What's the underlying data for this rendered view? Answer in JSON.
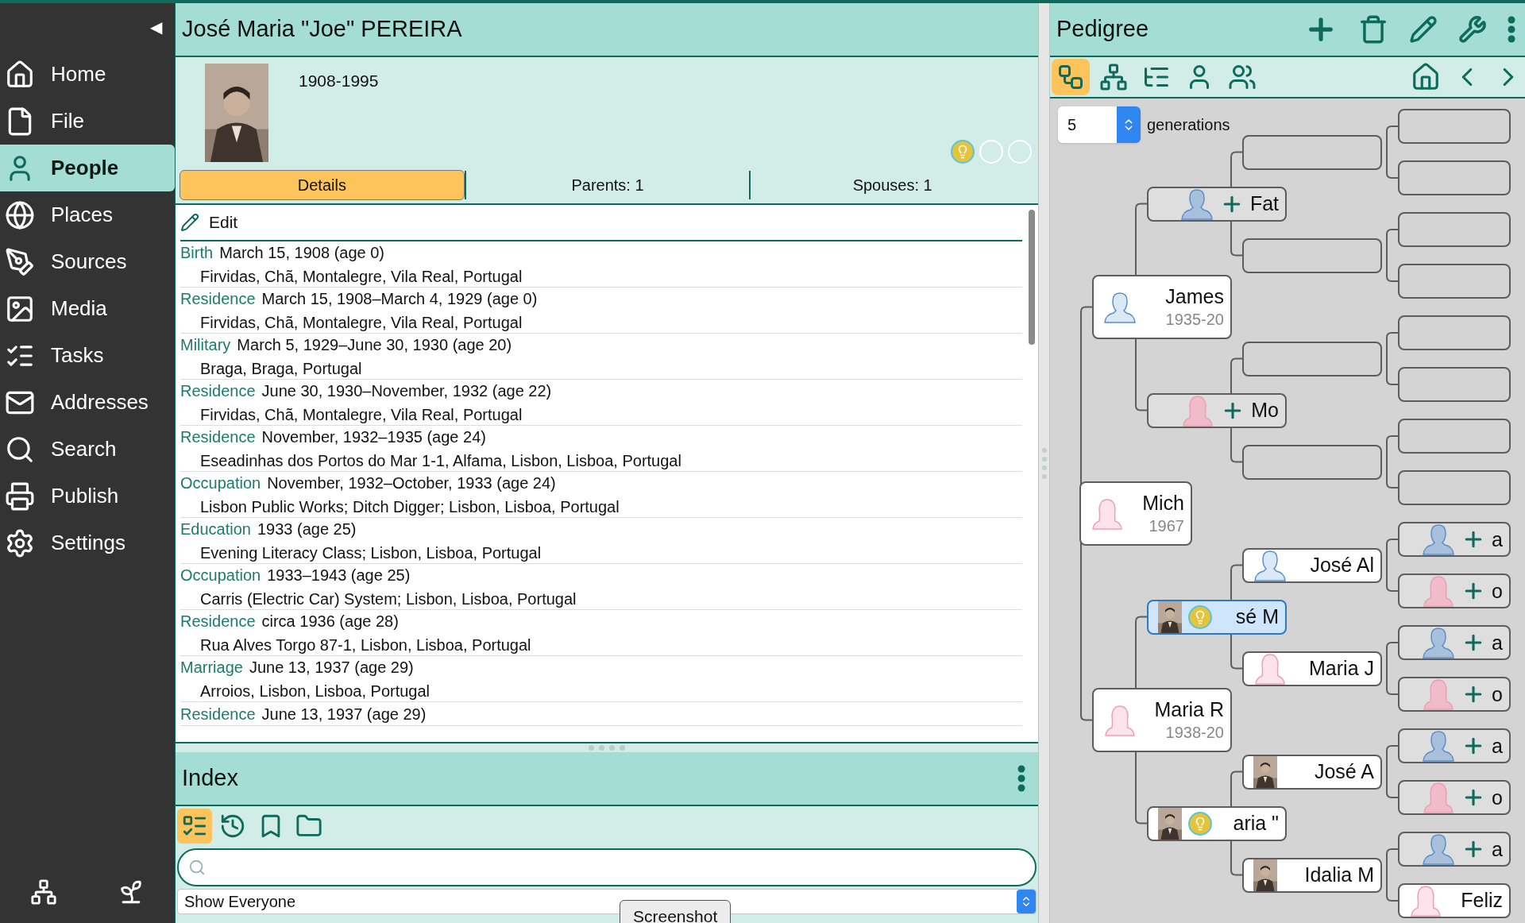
{
  "sidebar": {
    "collapse": "◀",
    "items": [
      {
        "label": "Home",
        "selected": false
      },
      {
        "label": "File",
        "selected": false
      },
      {
        "label": "People",
        "selected": true
      },
      {
        "label": "Places",
        "selected": false
      },
      {
        "label": "Sources",
        "selected": false
      },
      {
        "label": "Media",
        "selected": false
      },
      {
        "label": "Tasks",
        "selected": false
      },
      {
        "label": "Addresses",
        "selected": false
      },
      {
        "label": "Search",
        "selected": false
      },
      {
        "label": "Publish",
        "selected": false
      },
      {
        "label": "Settings",
        "selected": false
      }
    ]
  },
  "person": {
    "name": "José Maria \"Joe\" PEREIRA",
    "dates": "1908-1995",
    "hints": [
      {
        "filled": true
      },
      {
        "filled": false
      },
      {
        "filled": false
      }
    ]
  },
  "tabs": [
    {
      "label": "Details",
      "selected": true
    },
    {
      "label": "Parents: 1",
      "selected": false
    },
    {
      "label": "Spouses: 1",
      "selected": false
    }
  ],
  "edit_label": "Edit",
  "events": [
    {
      "type": "Birth",
      "date": "March 15, 1908 (age 0)",
      "place": "Firvidas, Chã, Montalegre, Vila Real, Portugal"
    },
    {
      "type": "Residence",
      "date": "March 15, 1908–March 4, 1929 (age 0)",
      "place": "Firvidas, Chã, Montalegre, Vila Real, Portugal"
    },
    {
      "type": "Military",
      "date": "March 5, 1929–June 30, 1930 (age 20)",
      "place": "Braga, Braga, Portugal"
    },
    {
      "type": "Residence",
      "date": "June 30, 1930–November, 1932 (age 22)",
      "place": "Firvidas, Chã, Montalegre, Vila Real, Portugal"
    },
    {
      "type": "Residence",
      "date": "November, 1932–1935 (age 24)",
      "place": "Eseadinhas dos Portos do Mar 1-1, Alfama, Lisbon, Lisboa, Portugal"
    },
    {
      "type": "Occupation",
      "date": "November, 1932–October, 1933 (age 24)",
      "place": "Lisbon Public Works; Ditch Digger; Lisbon, Lisboa, Portugal"
    },
    {
      "type": "Education",
      "date": "1933 (age 25)",
      "place": "Evening Literacy Class; Lisbon, Lisboa, Portugal"
    },
    {
      "type": "Occupation",
      "date": "1933–1943 (age 25)",
      "place": "Carris (Electric Car) System; Lisbon, Lisboa, Portugal"
    },
    {
      "type": "Residence",
      "date": "circa 1936 (age 28)",
      "place": "Rua Alves Torgo 87-1, Lisbon, Lisboa, Portugal"
    },
    {
      "type": "Marriage",
      "date": "June 13, 1937 (age 29)",
      "place": "Arroios, Lisbon, Lisboa, Portugal"
    },
    {
      "type": "Residence",
      "date": "June 13, 1937 (age 29)"
    }
  ],
  "index": {
    "title": "Index",
    "tools": [
      {
        "selected": true
      },
      {
        "selected": false
      },
      {
        "selected": false
      },
      {
        "selected": false
      }
    ],
    "filter": "Show Everyone"
  },
  "tooltip": "Screenshot",
  "pedigree": {
    "title": "Pedigree",
    "views": [
      {
        "selected": true
      },
      {
        "selected": false
      },
      {
        "selected": false
      },
      {
        "selected": false
      },
      {
        "selected": false
      }
    ],
    "generations": {
      "value": "5",
      "label": "generations"
    },
    "tree": {
      "kind": "woman",
      "name": "Mich",
      "dates": "1967",
      "selected": false,
      "children": [
        {
          "kind": "man",
          "name": "James",
          "dates": "1935-20",
          "selected": false,
          "children": [
            {
              "kind": "addman",
              "name": "Fat",
              "selected": false,
              "children": [
                {
                  "kind": "empty",
                  "selected": false,
                  "children": [
                    {
                      "kind": "empty",
                      "selected": false
                    },
                    {
                      "kind": "empty",
                      "selected": false
                    }
                  ]
                },
                {
                  "kind": "empty",
                  "selected": false,
                  "children": [
                    {
                      "kind": "empty",
                      "selected": false
                    },
                    {
                      "kind": "empty",
                      "selected": false
                    }
                  ]
                }
              ]
            },
            {
              "kind": "addwoman",
              "name": "Mo",
              "selected": false,
              "children": [
                {
                  "kind": "empty",
                  "selected": false,
                  "children": [
                    {
                      "kind": "empty",
                      "selected": false
                    },
                    {
                      "kind": "empty",
                      "selected": false
                    }
                  ]
                },
                {
                  "kind": "empty",
                  "selected": false,
                  "children": [
                    {
                      "kind": "empty",
                      "selected": false
                    },
                    {
                      "kind": "empty",
                      "selected": false
                    }
                  ]
                }
              ]
            }
          ]
        },
        {
          "kind": "woman",
          "name": "Maria R",
          "dates": "1938-20",
          "selected": false,
          "children": [
            {
              "hint": true,
              "name": "sé M",
              "selected": true,
              "children": [
                {
                  "kind": "man",
                  "name": "José Al",
                  "selected": false,
                  "children": [
                    {
                      "kind": "addman",
                      "name": "a",
                      "selected": false
                    },
                    {
                      "kind": "addwoman",
                      "name": "o",
                      "selected": false
                    }
                  ]
                },
                {
                  "kind": "woman",
                  "name": "Maria J",
                  "selected": false,
                  "children": [
                    {
                      "kind": "addman",
                      "name": "a",
                      "selected": false
                    },
                    {
                      "kind": "addwoman",
                      "name": "o",
                      "selected": false
                    }
                  ]
                }
              ]
            },
            {
              "hint": true,
              "name": "aria \"",
              "selected": false,
              "children": [
                {
                  "name": "José A",
                  "selected": false,
                  "children": [
                    {
                      "kind": "addman",
                      "name": "a",
                      "selected": false
                    },
                    {
                      "kind": "addwoman",
                      "name": "o",
                      "selected": false
                    }
                  ]
                },
                {
                  "name": "Idalia M",
                  "selected": false,
                  "children": [
                    {
                      "kind": "addman",
                      "name": "a",
                      "selected": false
                    },
                    {
                      "kind": "woman",
                      "name": "Feliz",
                      "selected": false
                    }
                  ]
                }
              ]
            }
          ]
        }
      ]
    }
  }
}
